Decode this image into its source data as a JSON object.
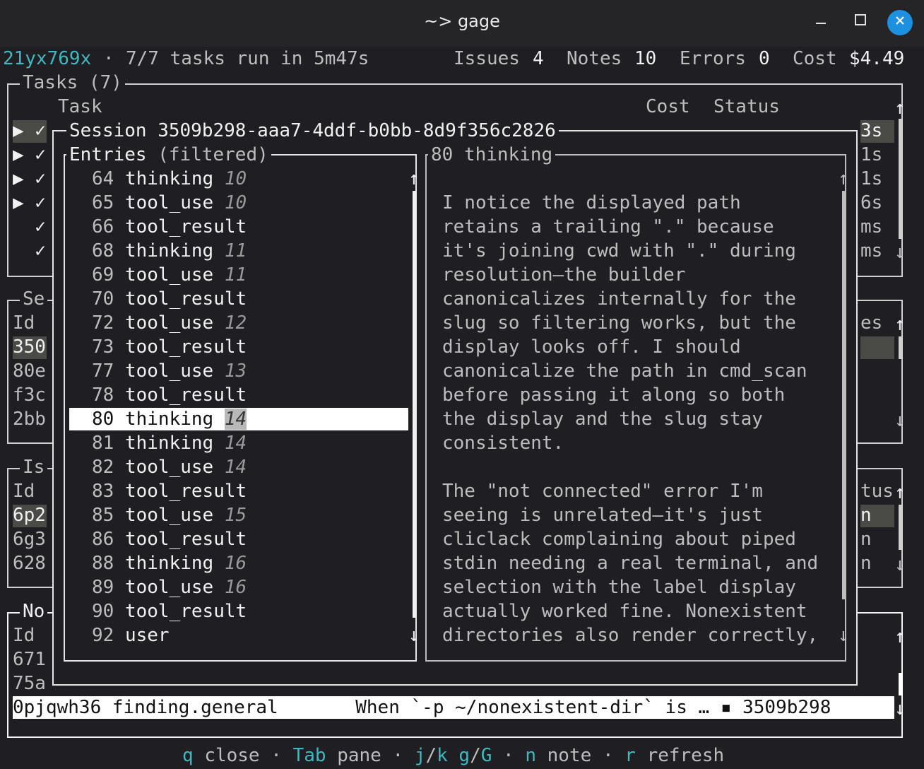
{
  "window": {
    "title": "~> gage"
  },
  "status_bar": {
    "run_id": "21yx769x",
    "separator": "·",
    "summary": "7/7 tasks run in 5m47s",
    "issues_label": "Issues",
    "issues_count": "4",
    "notes_label": "Notes",
    "notes_count": "10",
    "errors_label": "Errors",
    "errors_count": "0",
    "cost_label": "Cost",
    "cost_value": "$4.49"
  },
  "tasks_panel": {
    "title": "Tasks (7)",
    "col_task": "Task",
    "col_cost": "Cost",
    "col_status": "Status",
    "rows": [
      {
        "marker": "▶ ✓",
        "tail": "3s"
      },
      {
        "marker": "▶ ✓",
        "tail": "1s"
      },
      {
        "marker": "▶ ✓",
        "tail": "1s"
      },
      {
        "marker": "▶ ✓",
        "tail": "6s"
      },
      {
        "marker": "  ✓",
        "tail": "ms"
      },
      {
        "marker": "  ✓",
        "tail": "ms"
      }
    ]
  },
  "sessions_panel": {
    "title": "Se",
    "col_id": "Id",
    "col_tail": "es",
    "rows": [
      "350",
      "80e",
      "f3c",
      "2bb"
    ]
  },
  "issues_panel": {
    "title": "Is",
    "col_id": "Id",
    "col_tail": "tus",
    "rows": [
      {
        "id": "6p2",
        "tail": "n"
      },
      {
        "id": "6g3",
        "tail": "n"
      },
      {
        "id": "628",
        "tail": "n"
      }
    ]
  },
  "notes_panel": {
    "title": "No",
    "col_id": "Id",
    "rows": [
      "671",
      "75a"
    ],
    "selected_row": "0pjqwh36 finding.general       When `-p ~/nonexistent-dir` is … ▪ 3509b298"
  },
  "session_modal": {
    "title": "Session 3509b298-aaa7-4ddf-b0bb-8d9f356c2826",
    "entries_title": "Entries",
    "entries_filter": "(filtered)",
    "entries": [
      {
        "num": "64",
        "type": "thinking",
        "turn": "10"
      },
      {
        "num": "65",
        "type": "tool_use",
        "turn": "10"
      },
      {
        "num": "66",
        "type": "tool_result",
        "turn": ""
      },
      {
        "num": "68",
        "type": "thinking",
        "turn": "11"
      },
      {
        "num": "69",
        "type": "tool_use",
        "turn": "11"
      },
      {
        "num": "70",
        "type": "tool_result",
        "turn": ""
      },
      {
        "num": "72",
        "type": "tool_use",
        "turn": "12"
      },
      {
        "num": "73",
        "type": "tool_result",
        "turn": ""
      },
      {
        "num": "77",
        "type": "tool_use",
        "turn": "13"
      },
      {
        "num": "78",
        "type": "tool_result",
        "turn": ""
      },
      {
        "num": "80",
        "type": "thinking",
        "turn": "14"
      },
      {
        "num": "81",
        "type": "thinking",
        "turn": "14"
      },
      {
        "num": "82",
        "type": "tool_use",
        "turn": "14"
      },
      {
        "num": "83",
        "type": "tool_result",
        "turn": ""
      },
      {
        "num": "85",
        "type": "tool_use",
        "turn": "15"
      },
      {
        "num": "86",
        "type": "tool_result",
        "turn": ""
      },
      {
        "num": "88",
        "type": "thinking",
        "turn": "16"
      },
      {
        "num": "89",
        "type": "tool_use",
        "turn": "16"
      },
      {
        "num": "90",
        "type": "tool_result",
        "turn": ""
      },
      {
        "num": "92",
        "type": "user",
        "turn": ""
      }
    ],
    "selected_entry_num": "80",
    "detail_title": "80 thinking",
    "detail_lines": [
      "I notice the displayed path",
      "retains a trailing \".\" because",
      "it's joining cwd with \".\" during",
      "resolution—the builder",
      "canonicalizes internally for the",
      "slug so filtering works, but the",
      "display looks off. I should",
      "canonicalize the path in cmd_scan",
      "before passing it along so both",
      "the display and the slug stay",
      "consistent.",
      "",
      "The \"not connected\" error I'm",
      "seeing is unrelated—it's just",
      "cliclack complaining about piped",
      "stdin needing a real terminal, and",
      "selection with the label display",
      "actually worked fine. Nonexistent",
      "directories also render correctly,"
    ]
  },
  "footer": {
    "k1": "q",
    "a1": "close",
    "k2": "Tab",
    "a2": "pane",
    "k3a": "j",
    "k3sep": "/",
    "k3b": "k",
    "k4a": "g",
    "k4sep": "/",
    "k4b": "G",
    "k5": "n",
    "a5": "note",
    "k6": "r",
    "a6": "refresh",
    "dot": "·"
  },
  "icons": {
    "up_arrow": "↑",
    "down_arrow": "↓",
    "minimize": "—",
    "maximize": "☐",
    "close": "✕"
  }
}
